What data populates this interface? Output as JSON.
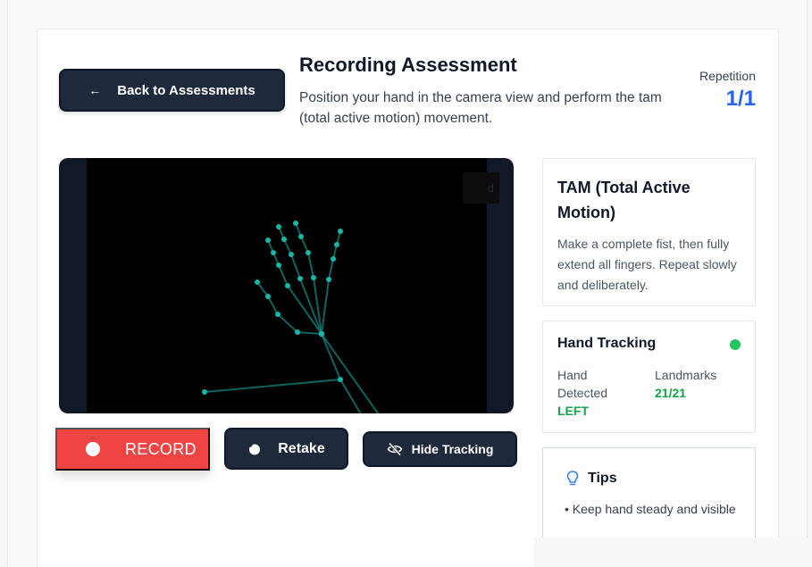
{
  "header": {
    "back_label": "Back to Assessments",
    "title": "Recording Assessment",
    "subtitle": "Position your hand in the camera view and perform the tam (total active motion) movement.",
    "repetition_label": "Repetition",
    "repetition_value": "1/1"
  },
  "video": {
    "overlay_badge": "d",
    "landmark_color": "#14b8a6"
  },
  "controls": {
    "record_label": "RECORD",
    "retake_label": "Retake",
    "hide_tracking_label": "Hide Tracking"
  },
  "tam_panel": {
    "title": "TAM (Total Active Motion)",
    "description": "Make a complete fist, then fully extend all fingers. Repeat slowly and deliberately."
  },
  "tracking_panel": {
    "title": "Hand Tracking",
    "hand_detected_label": "Hand Detected",
    "hand_detected_value": "LEFT",
    "landmarks_label": "Landmarks",
    "landmarks_value": "21/21",
    "status_color": "#22c55e"
  },
  "tips_panel": {
    "title": "Tips",
    "items": [
      "• Keep hand steady and visible"
    ]
  },
  "colors": {
    "accent": "#2563eb",
    "record": "#ef4444",
    "dark_button": "#1e293b",
    "success": "#16a34a"
  }
}
